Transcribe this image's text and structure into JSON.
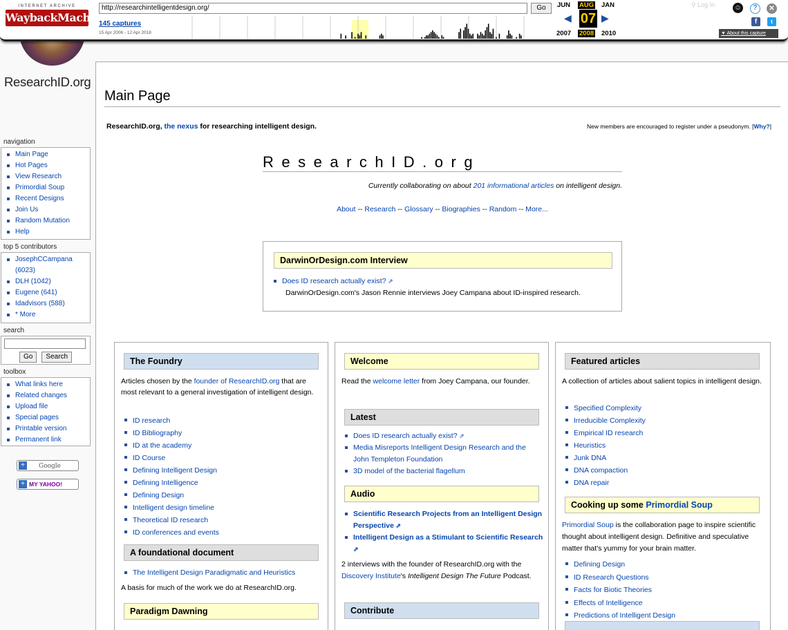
{
  "wayback": {
    "logo_top": "INTERNET ARCHIVE",
    "logo_main": "WaybackMachine",
    "url": "http://researchintelligentdesign.org/",
    "go": "Go",
    "captures": "145 captures",
    "range": "15 Apr 2006 - 12 Apr 2018",
    "months": [
      "JUN",
      "AUG",
      "JAN"
    ],
    "day": "07",
    "years": [
      "2007",
      "2008",
      "2010"
    ],
    "login": "Log In",
    "about": "About this capture",
    "sparkline": [
      0,
      0,
      0,
      0,
      0,
      0,
      0,
      0,
      0,
      0,
      0,
      0,
      0,
      0,
      0,
      0,
      0,
      0,
      0,
      0,
      0,
      0,
      0,
      0,
      0,
      0,
      0,
      0,
      0,
      0,
      0,
      0,
      0,
      0,
      0,
      0,
      0,
      0,
      0,
      0,
      0,
      0,
      0,
      0,
      0,
      0,
      0,
      0,
      0,
      0,
      0,
      0,
      0,
      0,
      0,
      0,
      0,
      0,
      0,
      0,
      0,
      0,
      0,
      0,
      0,
      0,
      0,
      0,
      0,
      0,
      0,
      0,
      0,
      0,
      0,
      0,
      0,
      0,
      0,
      0,
      0,
      0,
      0,
      0,
      0,
      0,
      0,
      0,
      0,
      0,
      0,
      0,
      0,
      0,
      0,
      0,
      0,
      0,
      0,
      0,
      3,
      0,
      0,
      2,
      0,
      0,
      0,
      4,
      0,
      1,
      0,
      3,
      2,
      4,
      0,
      0,
      2,
      0,
      0,
      0,
      0,
      0,
      0,
      0,
      0,
      2,
      3,
      2,
      0,
      0,
      0,
      0,
      0,
      0,
      0,
      0,
      0,
      0,
      0,
      0,
      0,
      0,
      0,
      0,
      0,
      0,
      0,
      0,
      0,
      0,
      0,
      0,
      1,
      0,
      1,
      2,
      2,
      3,
      4,
      5,
      4,
      3,
      2,
      1,
      0,
      2,
      1,
      0,
      0,
      0,
      0,
      0,
      0,
      0,
      0,
      0,
      4,
      6,
      0,
      5,
      7,
      9,
      6,
      3,
      2,
      3,
      0,
      0,
      3,
      2,
      4,
      3,
      2,
      5,
      7,
      9,
      4,
      3,
      6,
      0,
      1,
      0,
      3,
      0,
      0,
      0,
      0,
      2,
      5,
      3,
      2,
      0,
      0,
      1,
      0,
      3,
      2,
      0,
      0,
      0,
      0,
      0,
      0,
      0,
      0,
      0,
      0,
      0,
      0,
      0,
      0,
      0,
      0,
      0,
      0,
      0
    ],
    "highlight_color": "#ffffaa",
    "accent": "#ffcc00"
  },
  "site": {
    "logo_text": "ResearchID.org"
  },
  "sidebar": {
    "navigation_title": "navigation",
    "navigation": [
      "Main Page",
      "Hot Pages",
      "View Research",
      "Primordial Soup",
      "Recent Designs",
      "Join Us",
      "Random Mutation",
      "Help"
    ],
    "contributors_title": "top 5 contributors",
    "contributors": [
      "JosephCCampana (6023)",
      "DLH (1042)",
      "Eugene (641)",
      "Idadvisors (588)",
      "* More"
    ],
    "search_title": "search",
    "search_go": "Go",
    "search_search": "Search",
    "toolbox_title": "toolbox",
    "toolbox": [
      "What links here",
      "Related changes",
      "Upload file",
      "Special pages",
      "Printable version",
      "Permanent link"
    ],
    "google_badge": "Google",
    "yahoo_badge": "MY YAHOO!"
  },
  "page": {
    "title": "Main Page",
    "tagline_pre": "ResearchID.org, ",
    "tagline_link": "the nexus",
    "tagline_post": " for researching intelligent design.",
    "members_pre": "New members are encouraged to register under a pseudonym. [",
    "members_link": "Why?",
    "members_post": "]",
    "brand": "ResearchID.org",
    "collab_pre": "Currently collaborating on about ",
    "collab_link": "201 informational articles",
    "collab_post": " on intelligent design.",
    "topnav": [
      "About",
      "Research",
      "Glossary",
      "Biographies",
      "Random",
      "More..."
    ],
    "topnav_sep": " -- "
  },
  "interview": {
    "heading": "DarwinOrDesign.com Interview",
    "link": "Does ID research actually exist?",
    "text": "DarwinOrDesign.com's Jason Rennie interviews Joey Campana about ID-inspired research."
  },
  "foundry": {
    "heading": "The Foundry",
    "intro_pre": "Articles chosen by the ",
    "intro_link": "founder of ResearchID.org",
    "intro_post": " that are most relevant to a general investigation of intelligent design.",
    "items": [
      "ID research",
      "ID Bibliography",
      "ID at the academy",
      "ID Course",
      "Defining Intelligent Design",
      "Defining Intelligence",
      "Defining Design",
      "Intelligent design timeline",
      "Theoretical ID research",
      "ID conferences and events"
    ],
    "doc_heading": "A foundational document",
    "doc_link": "The Intelligent Design Paradigmatic and Heuristics",
    "doc_text": "A basis for much of the work we do at ResearchID.org.",
    "paradigm_heading": "Paradigm Dawning"
  },
  "welcome": {
    "heading": "Welcome",
    "text_pre": "Read the ",
    "text_link": "welcome letter",
    "text_post": " from Joey Campana, our founder.",
    "latest_heading": "Latest",
    "latest": [
      "Does ID research actually exist?",
      "Media Misreports Intelligent Design Research and the John Templeton Foundation",
      "3D model of the bacterial flagellum"
    ],
    "audio_heading": "Audio",
    "audio": [
      "Scientific Research Projects from an Intelligent Design Perspective",
      "Intelligent Design as a Stimulant to Scientific Research"
    ],
    "audio_text_pre": "2 interviews with the founder of ResearchID.org with the ",
    "audio_text_link": "Discovery Institute",
    "audio_text_mid": "'s ",
    "audio_text_em": "Intelligent Design The Future",
    "audio_text_post": " Podcast.",
    "contribute_heading": "Contribute"
  },
  "featured": {
    "heading": "Featured articles",
    "intro": "A collection of articles about salient topics in intelligent design.",
    "items": [
      "Specified Complexity",
      "Irreducible Complexity",
      "Empirical ID research",
      "Heuristics",
      "Junk DNA",
      "DNA compaction",
      "DNA repair"
    ],
    "soup_heading_pre": "Cooking up some ",
    "soup_heading_link": "Primordial Soup",
    "soup_link": "Primordial Soup",
    "soup_text": " is the collaboration page to inspire scientific thought about intelligent design. Definitive and speculative matter that's yummy for your brain matter.",
    "soup_items": [
      "Defining Design",
      "ID Research Questions",
      "Facts for Biotic Theories",
      "Effects of Intelligence",
      "Predictions of Intelligent Design"
    ]
  }
}
